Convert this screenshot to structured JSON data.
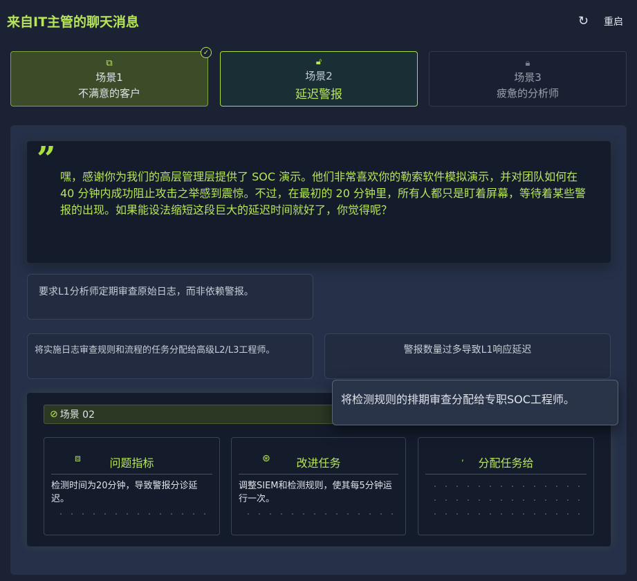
{
  "header": {
    "title": "来自IT主管的聊天消息",
    "reset_label": "重启",
    "reset_icon": "refresh-icon"
  },
  "tabs": [
    {
      "icon": "copy-icon",
      "number": "场景1",
      "name": "不满意的客户",
      "state": "completed"
    },
    {
      "icon": "unlock-icon",
      "number": "场景2",
      "name": "延迟警报",
      "state": "active"
    },
    {
      "icon": "lock-icon",
      "number": "场景3",
      "name": "疲惫的分析师",
      "state": "locked"
    }
  ],
  "message": {
    "quote_icon": "”",
    "text": "嘿，感谢你为我们的高层管理层提供了 SOC 演示。他们非常喜欢你的勒索软件模拟演示，并对团队如何在 40 分钟内成功阻止攻击之举感到震惊。不过，在最初的 20 分钟里，所有人都只是盯着屏幕，等待着某些警报的出现。如果能设法缩短这段巨大的延迟时间就好了，你觉得呢？"
  },
  "options": [
    "要求L1分析师定期审查原始日志，而非依赖警报。",
    "将实施日志审查规则和流程的任务分配给高级L2/L3工程师。",
    "警报数量过多导致L1响应延迟"
  ],
  "dragging_option": "将检测规则的排期审查分配给专职SOC工程师。",
  "scene_panel": {
    "label": "场景 02",
    "columns": [
      {
        "title": "问题指标",
        "icon": "alert-icon",
        "content": "检测时间为20分钟，导致警报分诊延迟。"
      },
      {
        "title": "改进任务",
        "icon": "upgrade-icon",
        "content": "调整SIEM和检测规则，使其每5分钟运行一次。"
      },
      {
        "title": "分配任务给",
        "icon": "user-icon",
        "content": ""
      }
    ]
  },
  "colors": {
    "accent": "#b7e55a",
    "background": "#1b2233",
    "panel": "#263049",
    "card": "#141c2c"
  }
}
